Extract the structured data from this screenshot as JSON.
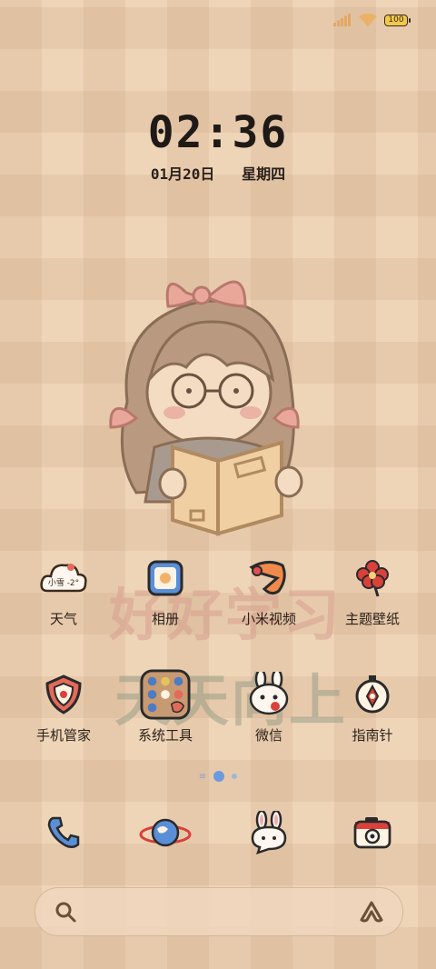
{
  "status": {
    "battery_level": "100",
    "icons": [
      "signal-icon",
      "wifi-icon",
      "battery-icon"
    ]
  },
  "lockclock": {
    "time": "02:36",
    "date": "01月20日",
    "weekday": "星期四"
  },
  "wallpaper": {
    "slogan_line1": "好好学习",
    "slogan_line2": "天天向上"
  },
  "apps": [
    {
      "label": "天气",
      "badge": "小雪 -2°",
      "icon": "weather-cloud-icon"
    },
    {
      "label": "相册",
      "icon": "gallery-icon"
    },
    {
      "label": "小米视频",
      "icon": "video-icon"
    },
    {
      "label": "主题壁纸",
      "icon": "theme-flower-icon"
    },
    {
      "label": "手机管家",
      "icon": "security-shield-icon"
    },
    {
      "label": "系统工具",
      "icon": "folder-icon"
    },
    {
      "label": "微信",
      "icon": "wechat-bunny-icon"
    },
    {
      "label": "指南针",
      "icon": "compass-icon"
    }
  ],
  "dock": [
    "phone-icon",
    "browser-planet-icon",
    "messages-bunny-icon",
    "camera-icon"
  ],
  "search": {
    "icons": [
      "search-icon",
      "assistant-icon"
    ]
  }
}
